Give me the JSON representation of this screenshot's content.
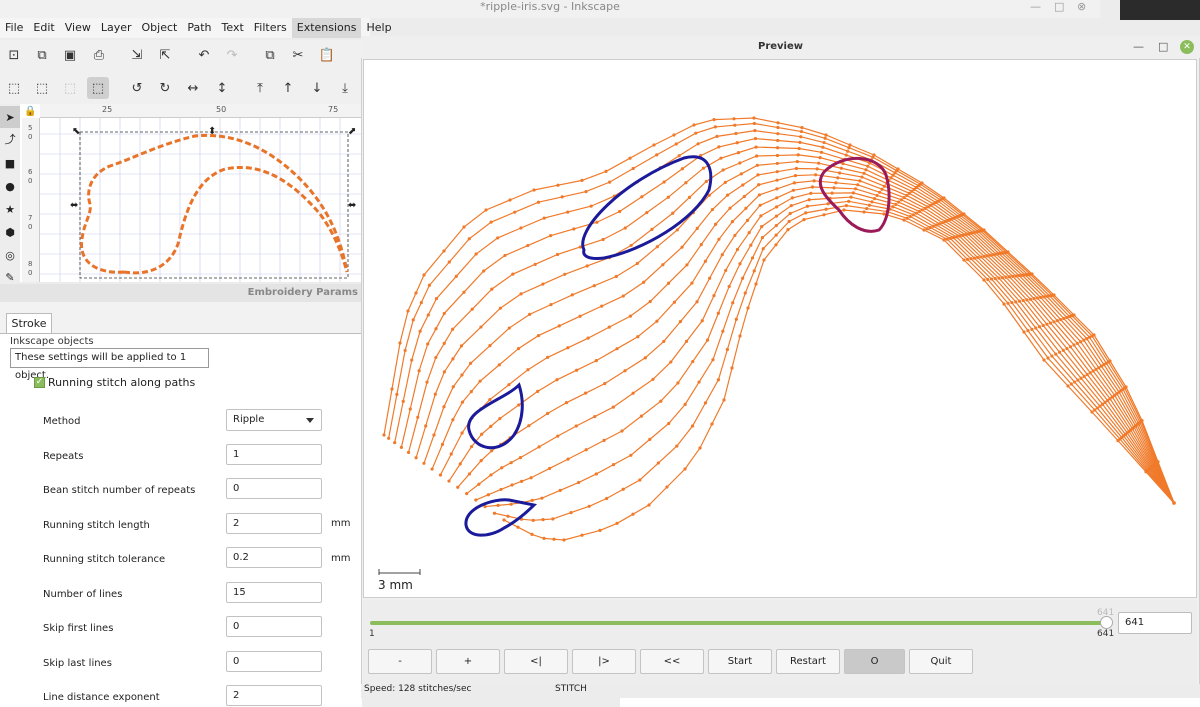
{
  "window": {
    "title": "*ripple-iris.svg - Inkscape"
  },
  "menu": [
    "File",
    "Edit",
    "View",
    "Layer",
    "Object",
    "Path",
    "Text",
    "Filters",
    "Extensions",
    "Help"
  ],
  "menu_active": "Extensions",
  "ruler": {
    "top_ticks": [
      "25",
      "50",
      "75"
    ],
    "left_ticks": [
      "5",
      "0",
      "6",
      "0",
      "7",
      "0",
      "8",
      "0"
    ]
  },
  "panel": {
    "header": "Embroidery Params",
    "tab": "Stroke",
    "group_title": "Inkscape objects",
    "group_note": "These settings will be applied to 1 object.",
    "checkbox_label": "Running stitch along paths",
    "params": [
      {
        "label": "Method",
        "value": "Ripple",
        "unit": ""
      },
      {
        "label": "Repeats",
        "value": "1",
        "unit": ""
      },
      {
        "label": "Bean stitch number of repeats",
        "value": "0",
        "unit": ""
      },
      {
        "label": "Running stitch length",
        "value": "2",
        "unit": "mm"
      },
      {
        "label": "Running stitch tolerance",
        "value": "0.2",
        "unit": "mm"
      },
      {
        "label": "Number of lines",
        "value": "15",
        "unit": ""
      },
      {
        "label": "Skip first lines",
        "value": "0",
        "unit": ""
      },
      {
        "label": "Skip last lines",
        "value": "0",
        "unit": ""
      },
      {
        "label": "Line distance exponent",
        "value": "2",
        "unit": ""
      }
    ]
  },
  "preview": {
    "title": "Preview",
    "scale_label": "3 mm",
    "slider": {
      "min": "1",
      "max": "641",
      "max_top": "641",
      "value": "641",
      "fraction": 1.0
    },
    "buttons": [
      "-",
      "+",
      "<|",
      "|>",
      "<<",
      "Start",
      "Restart",
      "O",
      "Quit"
    ],
    "active_button": "O",
    "status": {
      "speed": "Speed: 128 stitches/sec",
      "command": "STITCH"
    }
  },
  "colors": {
    "stitch": "#f07a2a",
    "blue_marks": "#1a1a9a",
    "purple_mark": "#9a1a5a",
    "accent_green": "#8cbd5c",
    "canvas_dash": "#e8742a"
  }
}
